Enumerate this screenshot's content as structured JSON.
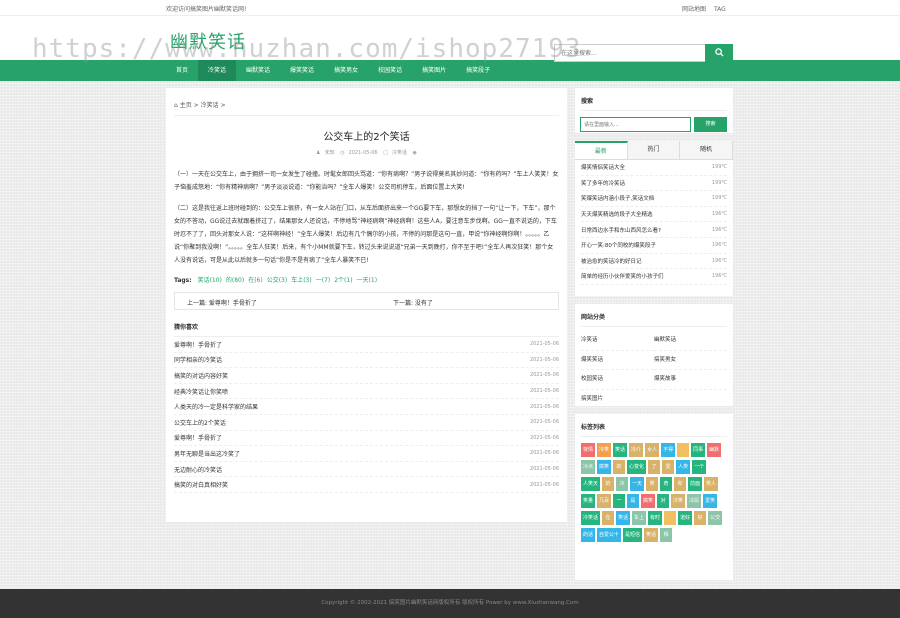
{
  "topbar": {
    "welcome": "欢迎访问搞笑图片幽默笑话网!",
    "links": [
      "网站地图",
      "TAG"
    ]
  },
  "header": {
    "logo": "幽默笑话",
    "watermark": "https://www.huzhan.com/ishop27193",
    "search_placeholder": "在这里搜索...",
    "search_icon": "search-icon"
  },
  "nav": {
    "items": [
      "首页",
      "冷笑话",
      "幽默笑话",
      "爆笑笑话",
      "搞笑男女",
      "校园笑话",
      "搞笑图片",
      "搞笑段子"
    ],
    "active_index": 1
  },
  "article": {
    "breadcrumb": {
      "home": "主页",
      "sep": ">",
      "category": "冷笑话",
      "tail": ">"
    },
    "title": "公交车上的2个笑话",
    "meta": {
      "author": "未知",
      "date": "2021-05-06",
      "category": "冷笑话",
      "views_icon": "eye-icon"
    },
    "paragraphs": [
      "（一）一天在公交车上，由于拥挤一司一女发生了碰撞。时髦女郎回头骂道：“你有病啊？”男子说得莫名其妙问道：“你有药吗？”车上人笑笑！女子恼羞成怒地：“你有精神病啊？”男子淡淡说道：“你能治吗？”全车人爆笑！公交司机停车，后面位置上大笑!",
      "（二）这是我往返上班时碰到的：公交车上很挤，有一女人站在门口，从车后面挤出来一个GG要下车，那想女的挡了一句“让一下，下车”，那个女的不答动，GG说过去就跟着挤过了，结果那女人还说话，不停地骂“神经病啊”神经病啊！这些人A，要注意车步伐啊。GG一直不说话的，下车时忍不了了，回头对那女人说：“这样啊神经！”全车人爆笑！后边有几个偶尔的小孩，不停的问那是这句一直，甲说“你神经啊你啊！。。。。。乙说“你聚到我没啊！”。。。。。全车人狂笑！后来，有个小MM就要下车，转过头来说说道“兄弟一天到晚打，你不至于吧!”全车人再次狂笑！那个女人没有说话，可是从此以后就多一句话“你是不是有病了”全车人暴笑不已!"
    ],
    "tags_label": "Tags:",
    "tags": [
      "笑话(10)",
      "的(80)",
      "在(6)",
      "公交(3)",
      "车上(3)",
      "一(7)",
      "2个(1)",
      "一天(1)"
    ],
    "prev": "上一篇: 爱尊啊！手骨折了",
    "next": "下一篇: 没有了"
  },
  "recommend": {
    "title": "猜你喜欢",
    "items": [
      {
        "text": "爱尊啊！手骨折了",
        "date": "2021-05-06"
      },
      {
        "text": "同学相亲的冷笑话",
        "date": "2021-05-06"
      },
      {
        "text": "搞笑的对话内容好笑",
        "date": "2021-05-06"
      },
      {
        "text": "经典冷笑话让你笑喷",
        "date": "2021-05-06"
      },
      {
        "text": "人类天的冷一定是科学家的结果",
        "date": "2021-05-06"
      },
      {
        "text": "公交车上的2个笑话",
        "date": "2021-05-06"
      },
      {
        "text": "爱尊啊！手骨折了",
        "date": "2021-05-06"
      },
      {
        "text": "男年无聊是当出这冷笑了",
        "date": "2021-05-06"
      },
      {
        "text": "无边耐心的冷笑话",
        "date": "2021-05-06"
      },
      {
        "text": "搞笑的对白真相好笑",
        "date": "2021-05-06"
      }
    ]
  },
  "sidebar": {
    "search": {
      "title": "搜索",
      "placeholder": "请在里面输入...",
      "button": "搜索"
    },
    "hot": {
      "tabs": [
        "最新",
        "热门",
        "随机"
      ],
      "active_index": 0,
      "items": [
        {
          "text": "爆笑情侣笑话大全",
          "n": "199℃"
        },
        {
          "text": "笑了多年的冷笑话",
          "n": "199℃"
        },
        {
          "text": "笑爆笑话内涵小段子,笑话文档",
          "n": "199℃"
        },
        {
          "text": "天天爆笑精选的段子大全精选",
          "n": "196℃"
        },
        {
          "text": "日常西边水手和东山西风怎么看?",
          "n": "196℃"
        },
        {
          "text": "开心一笑:80个同校的爆笑段子",
          "n": "196℃"
        },
        {
          "text": "被治愈的笑话冷的好日记",
          "n": "196℃"
        },
        {
          "text": "简单的经历小伙伴爱笑的小孩子们",
          "n": "196℃"
        }
      ]
    },
    "categories": {
      "title": "网站分类",
      "items": [
        "冷笑话",
        "幽默笑话",
        "爆笑笑话",
        "搞笑男女",
        "校园笑话",
        "爆笑故事",
        "搞笑图片"
      ]
    },
    "tagcloud": {
      "title": "标签列表",
      "tags": [
        {
          "t": "夜情",
          "c": "#f06e6e"
        },
        {
          "t": "冷笑",
          "c": "#f0a050"
        },
        {
          "t": "笑话",
          "c": "#26b57e"
        },
        {
          "t": "冷介",
          "c": "#d9b26a"
        },
        {
          "t": "女人",
          "c": "#d9b26a"
        },
        {
          "t": "不得",
          "c": "#35b6e8"
        },
        {
          "t": "",
          "c": "#f0c060"
        },
        {
          "t": "同事",
          "c": "#26b57e"
        },
        {
          "t": "幽默",
          "c": "#f06e6e"
        },
        {
          "t": "冷点",
          "c": "#8cc5a8"
        },
        {
          "t": "搞笑",
          "c": "#35b6e8"
        },
        {
          "t": "的",
          "c": "#d9b26a"
        },
        {
          "t": "心变化",
          "c": "#26b57e"
        },
        {
          "t": "了",
          "c": "#d9b26a"
        },
        {
          "t": "爱",
          "c": "#d9b26a"
        },
        {
          "t": "人类",
          "c": "#35b6e8"
        },
        {
          "t": "一个",
          "c": "#26b57e"
        },
        {
          "t": "人笑天",
          "c": "#26b57e"
        },
        {
          "t": "的",
          "c": "#d9b26a"
        },
        {
          "t": "冷",
          "c": "#8cc5a8"
        },
        {
          "t": "一天",
          "c": "#35b6e8"
        },
        {
          "t": "笑",
          "c": "#d9b26a"
        },
        {
          "t": "奇",
          "c": "#26b57e"
        },
        {
          "t": "你",
          "c": "#d9b26a"
        },
        {
          "t": "前面",
          "c": "#26b57e"
        },
        {
          "t": "男人",
          "c": "#d9b26a"
        },
        {
          "t": "笑量",
          "c": "#26b57e"
        },
        {
          "t": "几百",
          "c": "#d9b26a"
        },
        {
          "t": "一",
          "c": "#26b57e"
        },
        {
          "t": "是",
          "c": "#35b6e8"
        },
        {
          "t": "搞笑",
          "c": "#f06e6e"
        },
        {
          "t": "对",
          "c": "#26b57e"
        },
        {
          "t": "冷笑",
          "c": "#d9b26a"
        },
        {
          "t": "冷段",
          "c": "#8cc5a8"
        },
        {
          "t": "爱笑",
          "c": "#35b6e8"
        },
        {
          "t": "冷笑话",
          "c": "#26b57e"
        },
        {
          "t": "在",
          "c": "#d9b26a"
        },
        {
          "t": "笑话",
          "c": "#35b6e8"
        },
        {
          "t": "车上",
          "c": "#8cc5a8"
        },
        {
          "t": "有时",
          "c": "#26b57e"
        },
        {
          "t": "",
          "c": "#f0c060"
        },
        {
          "t": "道好",
          "c": "#26b57e"
        },
        {
          "t": "好",
          "c": "#d9b26a"
        },
        {
          "t": "公交",
          "c": "#8cc5a8"
        },
        {
          "t": "的话",
          "c": "#35b6e8"
        },
        {
          "t": "自爱公十",
          "c": "#35b6e8"
        },
        {
          "t": "是短信",
          "c": "#26b57e"
        },
        {
          "t": "笑话",
          "c": "#d9b26a"
        },
        {
          "t": "相",
          "c": "#8cc5a8"
        }
      ]
    }
  },
  "footer": {
    "text": "Copyright © 2002-2021 搞笑图片幽默笑话网版权所有 版权所有 Power by www.Xiuzhanwang.Com"
  }
}
